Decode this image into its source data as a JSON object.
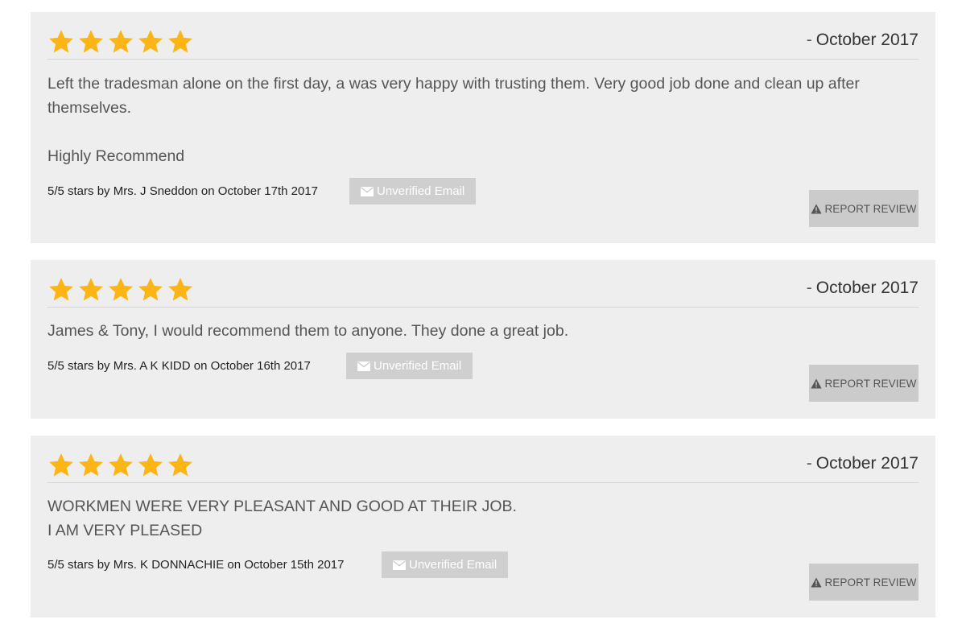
{
  "reviews": [
    {
      "rating": 5,
      "date_dash": "-",
      "date": "October 2017",
      "body": [
        "Left the tradesman alone on the first day, a was very happy with trusting them. Very good job done and clean up after themselves.",
        "Highly Recommend"
      ],
      "meta": "5/5 stars by Mrs. J Sneddon on October 17th 2017",
      "email_badge": "Unverified Email",
      "report_label": "REPORT REVIEW"
    },
    {
      "rating": 5,
      "date_dash": "-",
      "date": "October 2017",
      "body": [
        "James & Tony, I would recommend them to anyone. They done a great job."
      ],
      "meta": "5/5 stars by Mrs. A K KIDD on October 16th 2017",
      "email_badge": "Unverified Email",
      "report_label": "REPORT REVIEW"
    },
    {
      "rating": 5,
      "date_dash": "-",
      "date": "October 2017",
      "body": [
        "WORKMEN WERE VERY PLEASANT AND GOOD AT THEIR JOB.",
        "I AM VERY PLEASED"
      ],
      "meta": "5/5 stars by Mrs. K DONNACHIE on October 15th 2017",
      "email_badge": "Unverified Email",
      "report_label": "REPORT REVIEW"
    }
  ],
  "colors": {
    "star": "#FDB515",
    "card_background": "#eeeeee",
    "badge_background": "#cfcfcf",
    "button_background": "#cbcbcb"
  },
  "icons": {
    "star": "star-icon",
    "email": "envelope-icon",
    "report": "warning-icon"
  }
}
